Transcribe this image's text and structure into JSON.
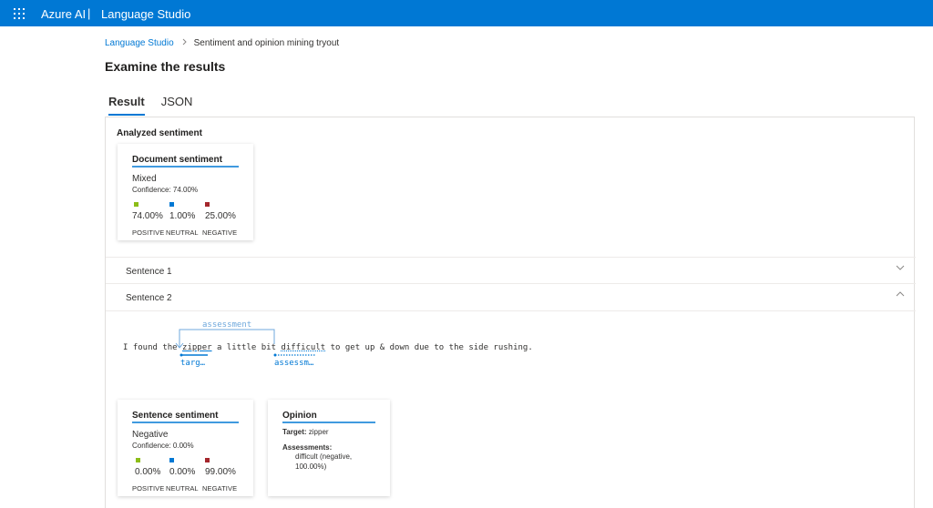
{
  "topbar": {
    "brand": "Azure AI",
    "separator": "|",
    "product": "Language Studio"
  },
  "breadcrumb": {
    "link": "Language Studio",
    "current": "Sentiment and opinion mining tryout"
  },
  "page_title": "Examine the results",
  "tabs": [
    {
      "label": "Result",
      "active": true
    },
    {
      "label": "JSON",
      "active": false
    }
  ],
  "analyzed_heading": "Analyzed sentiment",
  "document_card": {
    "title": "Document sentiment",
    "sentiment": "Mixed",
    "confidence": "Confidence: 74.00%",
    "metrics": [
      {
        "value": "74.00%",
        "label": "POSITIVE",
        "color": "#8cbd18"
      },
      {
        "value": "1.00%",
        "label": "NEUTRAL",
        "color": "#0078d4"
      },
      {
        "value": "25.00%",
        "label": "NEGATIVE",
        "color": "#a4262c"
      }
    ]
  },
  "sentences": [
    {
      "label": "Sentence 1",
      "expanded": false
    },
    {
      "label": "Sentence 2",
      "expanded": true
    }
  ],
  "sentence_text": {
    "before": "I found the ",
    "target": "zipper",
    "middle": " a little bit ",
    "assessment": "difficult",
    "after": " to get up & down due to the side rushing."
  },
  "annotations": {
    "top": "assessment",
    "target_short": "targ…",
    "assessment_short": "assessm…"
  },
  "sentence_card": {
    "title": "Sentence sentiment",
    "sentiment": "Negative",
    "confidence": "Confidence: 0.00%",
    "metrics": [
      {
        "value": "0.00%",
        "label": "POSITIVE",
        "color": "#8cbd18"
      },
      {
        "value": "0.00%",
        "label": "NEUTRAL",
        "color": "#0078d4"
      },
      {
        "value": "99.00%",
        "label": "NEGATIVE",
        "color": "#a4262c"
      }
    ]
  },
  "opinion_card": {
    "title": "Opinion",
    "target_label": "Target:",
    "target_value": "zipper",
    "assessments_label": "Assessments:",
    "assessment_line1": "difficult (negative,",
    "assessment_line2": "100.00%)"
  }
}
